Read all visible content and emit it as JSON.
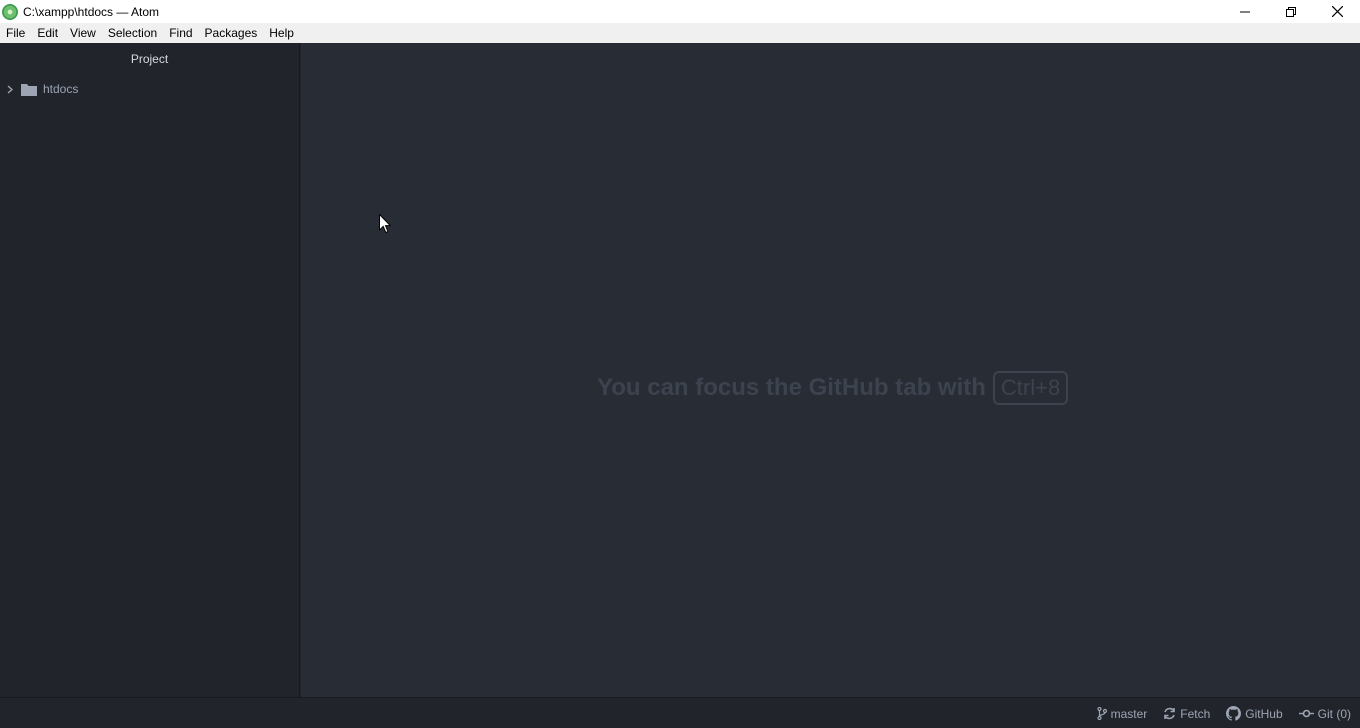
{
  "window": {
    "title": "C:\\xampp\\htdocs — Atom"
  },
  "menubar": {
    "items": [
      {
        "label": "File"
      },
      {
        "label": "Edit"
      },
      {
        "label": "View"
      },
      {
        "label": "Selection"
      },
      {
        "label": "Find"
      },
      {
        "label": "Packages"
      },
      {
        "label": "Help"
      }
    ]
  },
  "tree_view": {
    "title": "Project",
    "root": {
      "label": "htdocs",
      "expanded": false,
      "icon": "folder-icon"
    }
  },
  "editor": {
    "hint_text": "You can focus the GitHub tab with",
    "hint_shortcut": "Ctrl+8"
  },
  "statusbar": {
    "branch": "master",
    "fetch": "Fetch",
    "github": "GitHub",
    "git": "Git (0)"
  },
  "colors": {
    "panel_bg": "#21252b",
    "editor_bg": "#282c34",
    "text_muted": "#9da5b4",
    "hint_text": "#3d434e"
  }
}
